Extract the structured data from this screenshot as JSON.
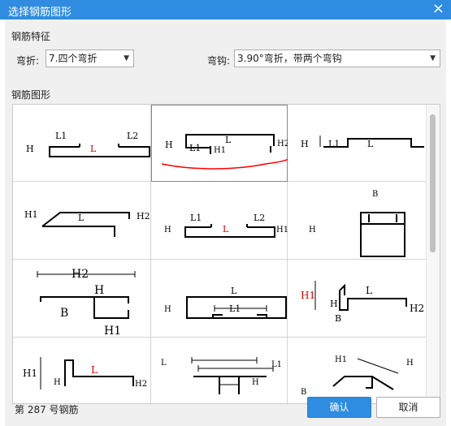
{
  "window": {
    "title": "选择钢筋图形",
    "close": "×"
  },
  "features": {
    "section_label": "钢筋特征",
    "bend_label": "弯折:",
    "bend_value": "7.四个弯折",
    "hook_label": "弯钩:",
    "hook_value": "3.90°弯折，带两个弯钩"
  },
  "shapes": {
    "section_label": "钢筋图形",
    "cells": [
      {
        "labels": [
          "H",
          "L1",
          "L",
          "L2"
        ]
      },
      {
        "labels": [
          "H",
          "L1",
          "H1",
          "L",
          "H2"
        ]
      },
      {
        "labels": [
          "H",
          "L1",
          "L"
        ]
      },
      {
        "labels": [
          "H1",
          "L",
          "H2"
        ]
      },
      {
        "labels": [
          "H",
          "L1",
          "L",
          "L2",
          "H1"
        ]
      },
      {
        "labels": [
          "B",
          "H"
        ]
      },
      {
        "labels": [
          "H2",
          "H",
          "B",
          "H1"
        ]
      },
      {
        "labels": [
          "L",
          "H",
          "L1"
        ]
      },
      {
        "labels": [
          "H1",
          "L",
          "H",
          "B",
          "H2"
        ]
      },
      {
        "labels": [
          "H1",
          "H",
          "L",
          "H2"
        ]
      },
      {
        "labels": [
          "L",
          "L1",
          "H"
        ]
      },
      {
        "labels": [
          "H1",
          "H",
          "B"
        ]
      }
    ]
  },
  "footer": {
    "status": "第 287 号钢筋",
    "ok_label": "确认",
    "cancel_label": "取消"
  },
  "colors": {
    "accent": "#2f8ce0",
    "highlight_label": "#d40000",
    "mark": "#ff0000"
  }
}
